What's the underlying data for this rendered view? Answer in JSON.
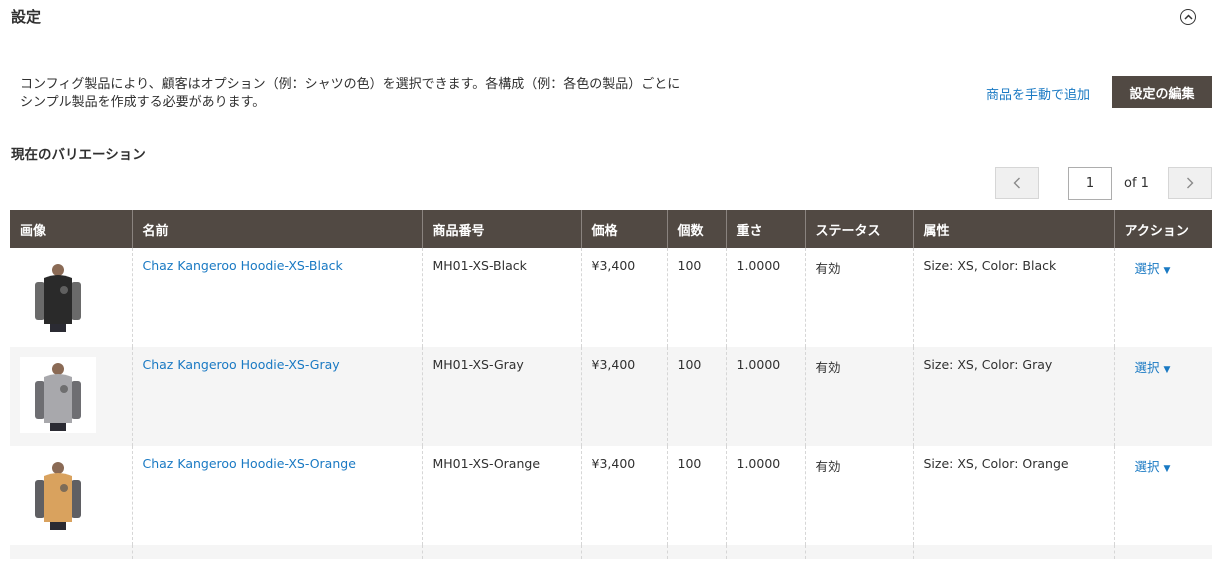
{
  "section": {
    "title": "設定",
    "intro_line1": "コンフィグ製品により、顧客はオプション（例：シャツの色）を選択できます。各構成（例：各色の製品）ごとに",
    "intro_line2": "シンプル製品を作成する必要があります。",
    "add_manually_label": "商品を手動で追加",
    "edit_config_label": "設定の編集"
  },
  "variations": {
    "title": "現在のバリエーション",
    "pager": {
      "current_page": "1",
      "of_label": "of 1"
    },
    "columns": [
      "画像",
      "名前",
      "商品番号",
      "価格",
      "個数",
      "重さ",
      "ステータス",
      "属性",
      "アクション"
    ],
    "rows": [
      {
        "name": "Chaz Kangeroo Hoodie-XS-Black",
        "sku": "MH01-XS-Black",
        "price": "¥3,400",
        "qty": "100",
        "weight": "1.0000",
        "status": "有効",
        "attributes": "Size: XS, Color: Black",
        "action": "選択",
        "body_color": "#2a2a2a",
        "sleeve_color": "#6a6a6a"
      },
      {
        "name": "Chaz Kangeroo Hoodie-XS-Gray",
        "sku": "MH01-XS-Gray",
        "price": "¥3,400",
        "qty": "100",
        "weight": "1.0000",
        "status": "有効",
        "attributes": "Size: XS, Color: Gray",
        "action": "選択",
        "body_color": "#a8a8ac",
        "sleeve_color": "#6e6e72"
      },
      {
        "name": "Chaz Kangeroo Hoodie-XS-Orange",
        "sku": "MH01-XS-Orange",
        "price": "¥3,400",
        "qty": "100",
        "weight": "1.0000",
        "status": "有効",
        "attributes": "Size: XS, Color: Orange",
        "action": "選択",
        "body_color": "#d9a25e",
        "sleeve_color": "#5f5f63"
      }
    ]
  },
  "colors": {
    "accent_link": "#1979c3",
    "header_bg": "#514943"
  }
}
